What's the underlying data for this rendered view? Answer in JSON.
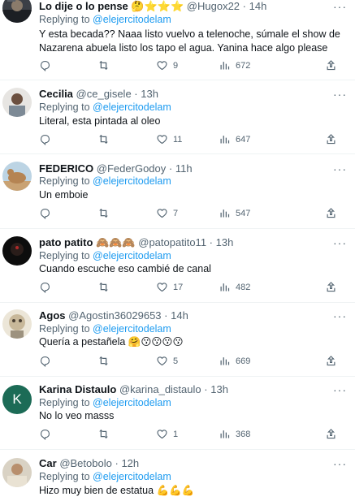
{
  "tweets": [
    {
      "name": "Lo dije o lo pense",
      "name_emoji": "🤔⭐⭐⭐",
      "handle": "@Hugox22",
      "time": "14h",
      "replying_prefix": "Replying to",
      "replying_to": "@elejercitodelam",
      "text": "Y esta becada?? Naaa listo vuelvo a telenoche, súmale el show de Nazarena abuela listo los tapo el agua. Yanina hace algo please",
      "reply_count": "",
      "retweet_count": "",
      "like_count": "9",
      "view_count": "672"
    },
    {
      "name": "Cecilia",
      "name_emoji": "",
      "handle": "@ce_gisele",
      "time": "13h",
      "replying_prefix": "Replying to",
      "replying_to": "@elejercitodelam",
      "text": "Literal, esta pintada al oleo",
      "reply_count": "",
      "retweet_count": "",
      "like_count": "11",
      "view_count": "647"
    },
    {
      "name": "FEDERICO",
      "name_emoji": "",
      "handle": "@FederGodoy",
      "time": "11h",
      "replying_prefix": "Replying to",
      "replying_to": "@elejercitodelam",
      "text": "Un emboie",
      "reply_count": "",
      "retweet_count": "",
      "like_count": "7",
      "view_count": "547"
    },
    {
      "name": "pato patito",
      "name_emoji": "🙈🙈🙈",
      "handle": "@patopatito11",
      "time": "13h",
      "replying_prefix": "Replying to",
      "replying_to": "@elejercitodelam",
      "text": "Cuando escuche eso cambié de canal",
      "reply_count": "",
      "retweet_count": "",
      "like_count": "17",
      "view_count": "482"
    },
    {
      "name": "Agos",
      "name_emoji": "",
      "handle": "@Agostin36029653",
      "time": "14h",
      "replying_prefix": "Replying to",
      "replying_to": "@elejercitodelam",
      "text": "Quería a pestañela 🤗😗😗😗😗",
      "reply_count": "",
      "retweet_count": "",
      "like_count": "5",
      "view_count": "669"
    },
    {
      "name": "Karina Distaulo",
      "name_emoji": "",
      "handle": "@karina_distaulo",
      "time": "13h",
      "replying_prefix": "Replying to",
      "replying_to": "@elejercitodelam",
      "text": "No lo veo masss",
      "reply_count": "",
      "retweet_count": "",
      "like_count": "1",
      "view_count": "368",
      "avatar_letter": "K"
    },
    {
      "name": "Car",
      "name_emoji": "",
      "handle": "@Betobolo",
      "time": "12h",
      "replying_prefix": "Replying to",
      "replying_to": "@elejercitodelam",
      "text": "Hizo muy bien de estatua 💪💪💪",
      "reply_count": "",
      "retweet_count": "",
      "like_count": "",
      "view_count": ""
    }
  ],
  "icons": {
    "reply": "reply-icon",
    "retweet": "retweet-icon",
    "like": "heart-icon",
    "views": "views-icon",
    "share": "share-icon",
    "more": "more-icon"
  },
  "colors": {
    "mention": "#1d9bf0",
    "secondary_text": "#536471",
    "divider": "#eff3f4",
    "karina_avatar": "#1c6b56"
  }
}
